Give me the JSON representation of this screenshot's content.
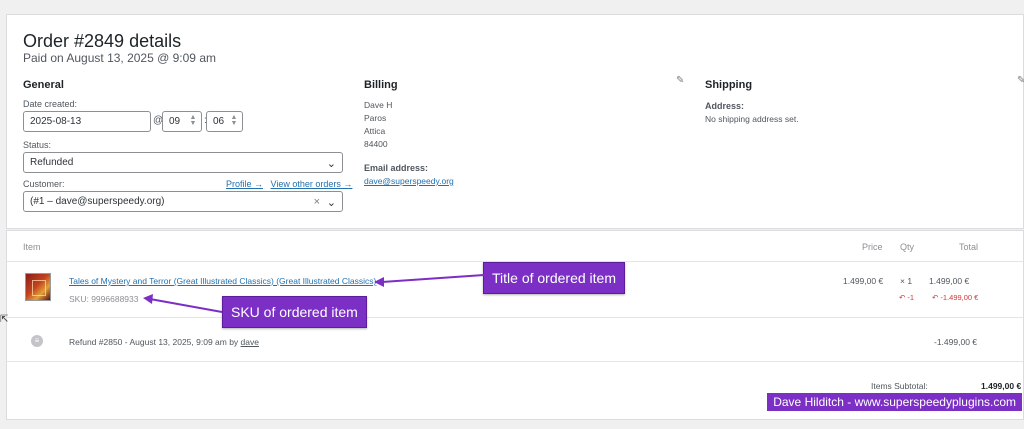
{
  "order": {
    "title": "Order #2849 details",
    "subtitle": "Paid on August 13, 2025 @ 9:09 am"
  },
  "general": {
    "heading": "General",
    "date_label": "Date created:",
    "date_value": "2025-08-13",
    "at_sign": "@",
    "hour": "09",
    "minute": "06",
    "colon": ":",
    "status_label": "Status:",
    "status_value": "Refunded",
    "customer_label": "Customer:",
    "profile_link": "Profile →",
    "view_orders_link": "View other orders →",
    "customer_value": "(#1 – dave@superspeedy.org)",
    "clear": "×"
  },
  "billing": {
    "heading": "Billing",
    "lines": [
      "Dave H",
      "Paros",
      "Attica",
      "84400"
    ],
    "email_label": "Email address:",
    "email": "dave@superspeedy.org"
  },
  "shipping": {
    "heading": "Shipping",
    "address_label": "Address:",
    "address_value": "No shipping address set."
  },
  "items": {
    "headers": {
      "item": "Item",
      "price": "Price",
      "qty": "Qty",
      "total": "Total"
    },
    "row": {
      "title": "Tales of Mystery and Terror (Great Illustrated Classics) (Great Illustrated Classics)",
      "sku": "SKU: 9996688933",
      "price": "1.499,00 €",
      "qty": "× 1",
      "total": "1.499,00 €",
      "qty_refunded": "-1",
      "total_refunded": "-1.499,00 €"
    },
    "refund": {
      "text": "Refund #2850 - August 13, 2025, 9:09 am by ",
      "by": "dave",
      "amount": "-1.499,00 €"
    },
    "subtotal_label": "Items Subtotal:",
    "subtotal_value": "1.499,00 €"
  },
  "callouts": {
    "title": "Title of ordered item",
    "sku": "SKU of ordered item"
  },
  "watermark": "Dave Hilditch - www.superspeedyplugins.com",
  "icons": {
    "pencil": "✎",
    "undo": "↶",
    "chevron": "⌄",
    "spin": "▲▼"
  }
}
